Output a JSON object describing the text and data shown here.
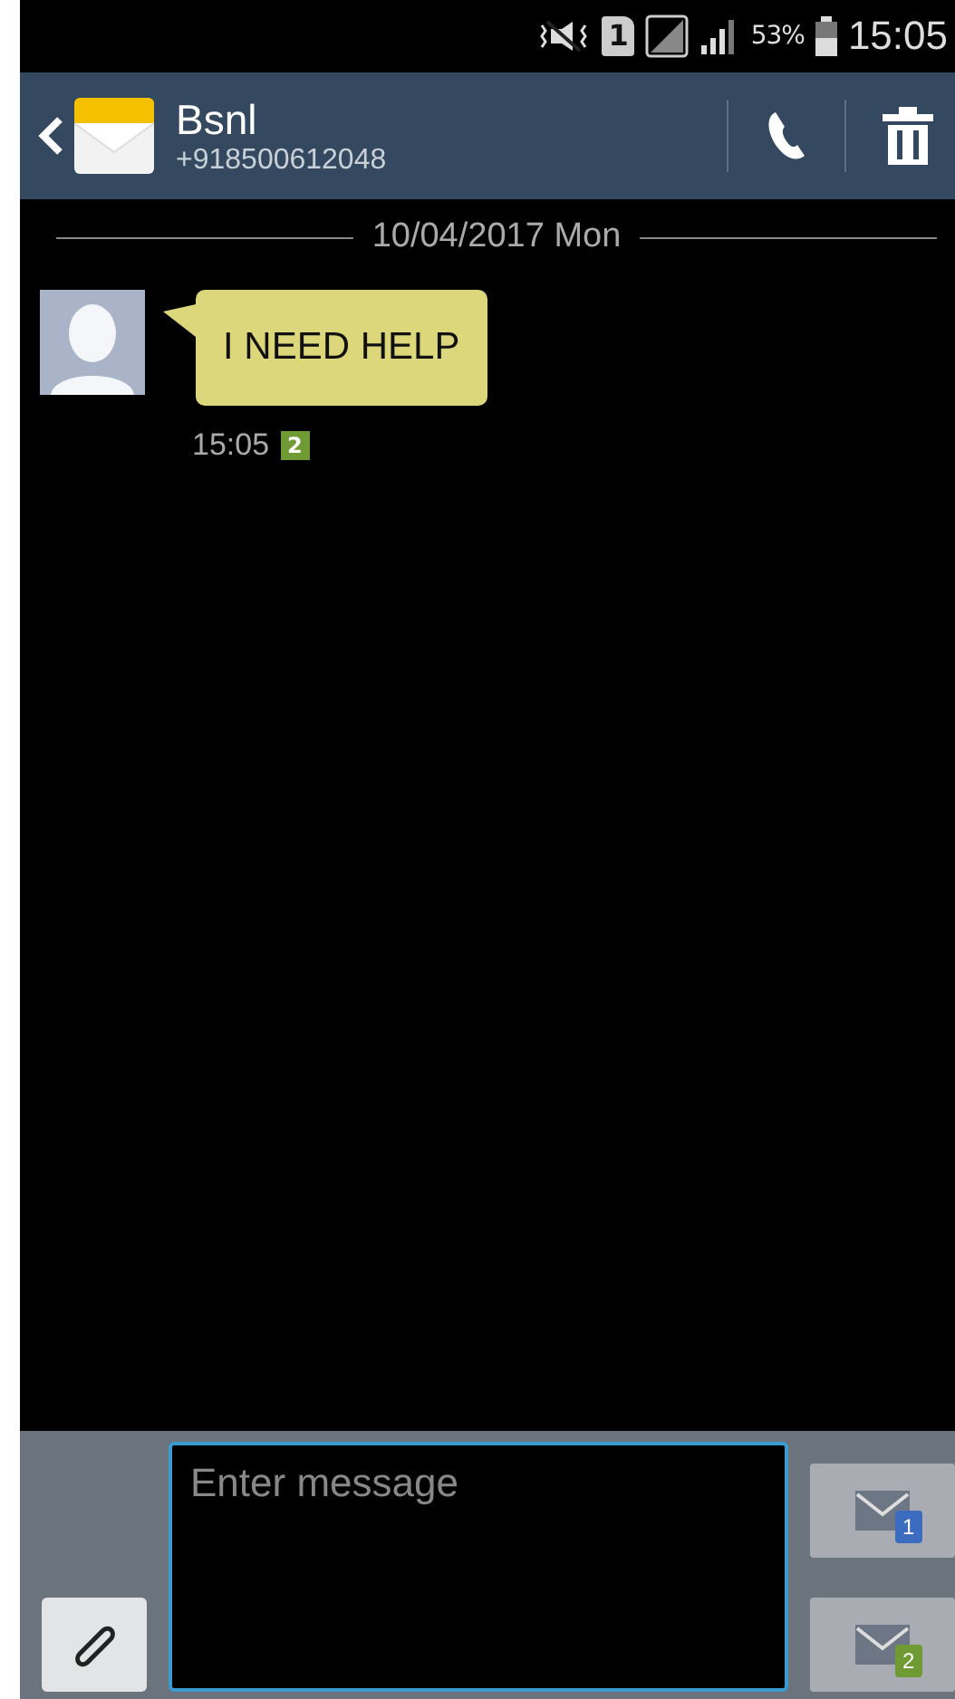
{
  "status_bar": {
    "sim_slot": "1",
    "battery": "53%",
    "time": "15:05"
  },
  "header": {
    "title": "Bsnl",
    "subtitle": "+918500612048"
  },
  "date_divider": "10/04/2017 Mon",
  "messages": [
    {
      "text": "I NEED HELP",
      "time": "15:05",
      "sim": "2"
    }
  ],
  "composer": {
    "placeholder": "Enter message"
  },
  "send_buttons": [
    {
      "sim": "1",
      "color": "#3b6cc0"
    },
    {
      "sim": "2",
      "color": "#6f9a34"
    }
  ]
}
